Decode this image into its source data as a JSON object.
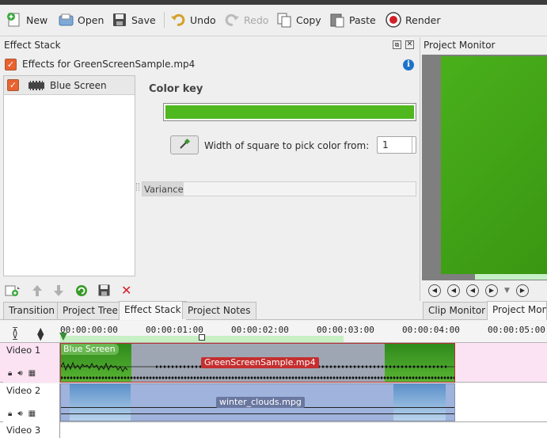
{
  "toolbar": {
    "new": "New",
    "open": "Open",
    "save": "Save",
    "undo": "Undo",
    "redo": "Redo",
    "copy": "Copy",
    "paste": "Paste",
    "render": "Render"
  },
  "effect_stack": {
    "title": "Effect Stack",
    "effects_for": "Effects for GreenScreenSample.mp4",
    "effects": [
      {
        "name": "Blue Screen",
        "enabled": true
      }
    ],
    "color_key_label": "Color key",
    "color_key_value": "#4fb81f",
    "width_label": "Width of square to pick color from:",
    "width_value": "1",
    "variance_label": "Variance"
  },
  "project_monitor": {
    "title": "Project Monitor"
  },
  "tabs": {
    "left": [
      "Transition",
      "Project Tree",
      "Effect Stack",
      "Project Notes"
    ],
    "active_left": "Effect Stack",
    "right": [
      "Clip Monitor",
      "Project Monit"
    ]
  },
  "timeline": {
    "ruler": [
      "00:00:00:00",
      "00:00:01:00",
      "00:00:02:00",
      "00:00:03:00",
      "00:00:04:00",
      "00:00:05:00"
    ],
    "tracks": [
      {
        "name": "Video 1",
        "clip_effect": "Blue Screen",
        "clip_name": "GreenScreenSample.mp4"
      },
      {
        "name": "Video 2",
        "clip_name": "winter_clouds.mpg"
      },
      {
        "name": "Video 3"
      }
    ]
  },
  "colors": {
    "accent": "#e9622f",
    "green": "#4fb81f",
    "track_pink": "#fbe3f3"
  }
}
